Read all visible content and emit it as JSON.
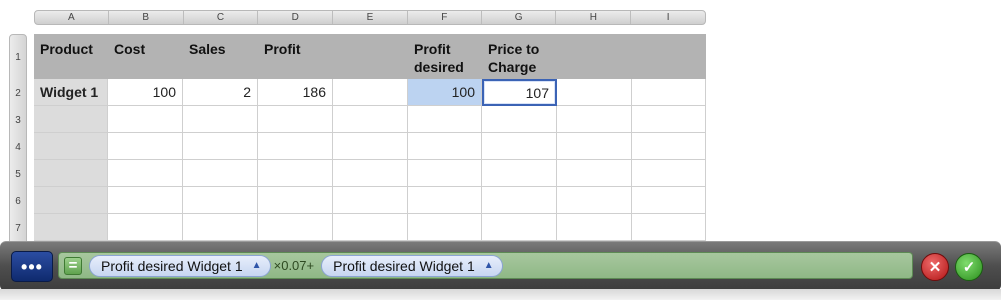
{
  "columns": [
    "A",
    "B",
    "C",
    "D",
    "E",
    "F",
    "G",
    "H",
    "I"
  ],
  "rows": [
    "1",
    "2",
    "3",
    "4",
    "5",
    "6",
    "7"
  ],
  "header_row": {
    "A": "Product",
    "B": "Cost",
    "C": "Sales",
    "D": "Profit",
    "E": "",
    "F": "Profit desired",
    "G": "Price to Charge",
    "H": "",
    "I": ""
  },
  "data_row": {
    "A": "Widget 1",
    "B": "100",
    "C": "2",
    "D": "186",
    "E": "",
    "F": "100",
    "G": "107",
    "H": "",
    "I": ""
  },
  "formula_bar": {
    "more_label": "•••",
    "equals_label": "=",
    "token1": "Profit desired Widget 1",
    "operator": "×0.07+",
    "token2": "Profit desired Widget 1",
    "token_arrow": "▲",
    "cancel_label": "✕",
    "confirm_label": "✓"
  },
  "colors": {
    "header_bg": "#b3b3b3",
    "source_cell": "#bcd3f1",
    "edit_border": "#3b63b5",
    "formula_field": "#9cc193",
    "cancel": "#c62020",
    "confirm": "#3aa02a"
  }
}
